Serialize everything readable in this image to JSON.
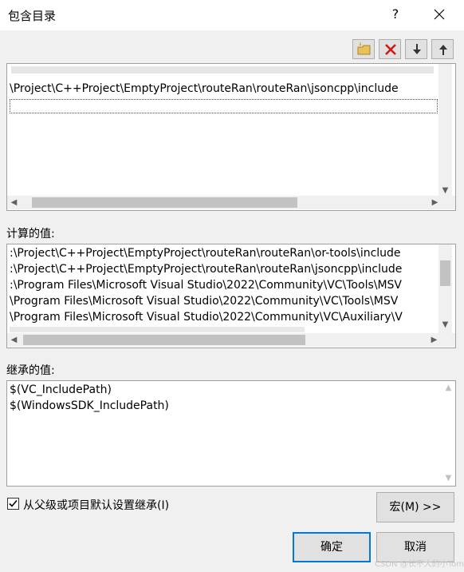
{
  "window": {
    "title": "包含目录",
    "help_label": "?"
  },
  "toolbar": {
    "buttons": [
      {
        "name": "new-line-button",
        "icon": "folder-new-icon"
      },
      {
        "name": "delete-line-button",
        "icon": "delete-x-icon"
      },
      {
        "name": "move-down-button",
        "icon": "arrow-down-icon"
      },
      {
        "name": "move-up-button",
        "icon": "arrow-up-icon"
      }
    ]
  },
  "editor": {
    "lines": [
      "\\Project\\C++Project\\EmptyProject\\routeRan\\routeRan\\jsoncpp\\include"
    ]
  },
  "computed": {
    "label": "计算的值:",
    "lines": [
      ":\\Project\\C++Project\\EmptyProject\\routeRan\\routeRan\\or-tools\\include",
      ":\\Project\\C++Project\\EmptyProject\\routeRan\\routeRan\\jsoncpp\\include",
      ":\\Program Files\\Microsoft Visual Studio\\2022\\Community\\VC\\Tools\\MSV",
      "\\Program Files\\Microsoft Visual Studio\\2022\\Community\\VC\\Tools\\MSV",
      "\\Program Files\\Microsoft Visual Studio\\2022\\Community\\VC\\Auxiliary\\V"
    ]
  },
  "inherited": {
    "label": "继承的值:",
    "lines": [
      "$(VC_IncludePath)",
      "$(WindowsSDK_IncludePath)"
    ]
  },
  "inherit_checkbox": {
    "checked": true,
    "label": "从父级或项目默认设置继承(I)"
  },
  "buttons": {
    "macro": "宏(M) >>",
    "ok": "确定",
    "cancel": "取消"
  },
  "watermark": "CSDN @长不大的小Tom"
}
